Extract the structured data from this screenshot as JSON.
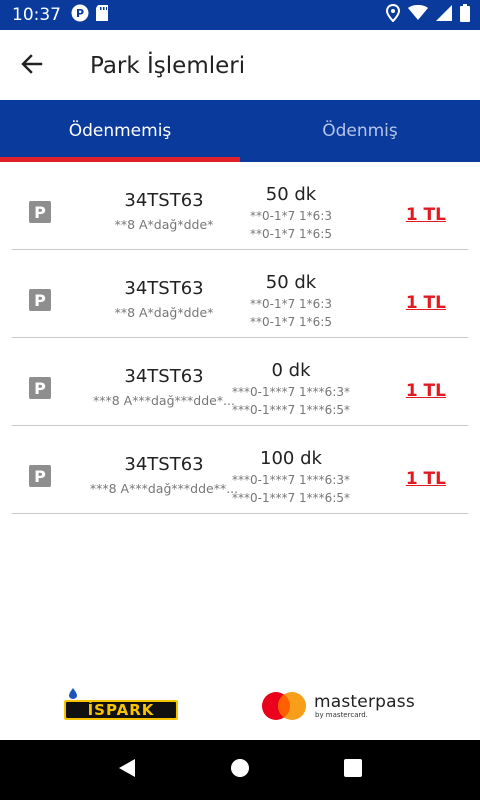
{
  "status_bar": {
    "time": "10:37",
    "icons": [
      "p-icon",
      "sd-card-icon",
      "location-icon",
      "wifi-icon",
      "signal-icon",
      "battery-icon"
    ]
  },
  "header": {
    "title": "Park İşlemleri",
    "back_icon": "arrow-left-icon"
  },
  "tabs": [
    {
      "label": "Ödenmemiş",
      "active": true
    },
    {
      "label": "Ödenmiş",
      "active": false
    }
  ],
  "parking_list": [
    {
      "plate": "34TST63",
      "location": "**8 A*dağ*dde*",
      "duration": "50 dk",
      "start": "**0-1*7 1*6:3",
      "end": "**0-1*7 1*6:5",
      "price": "1 TL"
    },
    {
      "plate": "34TST63",
      "location": "**8 A*dağ*dde*",
      "duration": "50 dk",
      "start": "**0-1*7 1*6:3",
      "end": "**0-1*7 1*6:5",
      "price": "1 TL"
    },
    {
      "plate": "34TST63",
      "location": "***8 A***dağ***dde*...",
      "duration": "0 dk",
      "start": "***0-1***7 1***6:3*",
      "end": "***0-1***7 1***6:5*",
      "price": "1 TL"
    },
    {
      "plate": "34TST63",
      "location": "***8 A***dağ***dde**...",
      "duration": "100 dk",
      "start": "***0-1***7 1***6:3*",
      "end": "***0-1***7 1***6:5*",
      "price": "1 TL"
    }
  ],
  "footer": {
    "ispark_logo_text": "İSPARK",
    "masterpass_name": "masterpass",
    "masterpass_sub": "by mastercard."
  },
  "colors": {
    "primary": "#0a3a9c",
    "accent": "#e0202a",
    "price": "#e01a20"
  },
  "nav": {
    "back": "triangle-back-icon",
    "home": "circle-home-icon",
    "recents": "square-recents-icon"
  }
}
